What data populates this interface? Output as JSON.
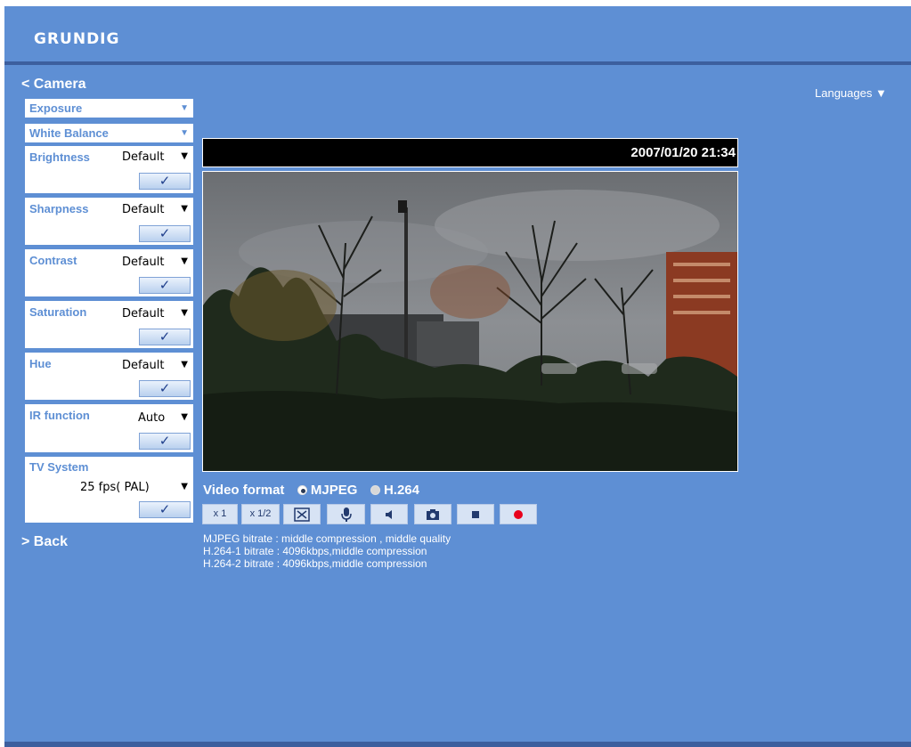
{
  "brand": {
    "logo": "GRUNDIG"
  },
  "nav": {
    "camera_link": "< Camera",
    "back_link": "> Back",
    "languages": "Languages ▼"
  },
  "sidebar": {
    "dropdowns": [
      {
        "label": "Exposure",
        "arrow": "▼"
      },
      {
        "label": "White Balance",
        "arrow": "▼"
      }
    ],
    "settings": [
      {
        "label": "Brightness",
        "value": "Default"
      },
      {
        "label": "Sharpness",
        "value": "Default"
      },
      {
        "label": "Contrast",
        "value": "Default"
      },
      {
        "label": "Saturation",
        "value": "Default"
      },
      {
        "label": "Hue",
        "value": "Default"
      },
      {
        "label": "IR function",
        "value": "Auto"
      },
      {
        "label": "TV System",
        "value": "25 fps( PAL)"
      }
    ],
    "select_caret": "▼",
    "apply_glyph": "✓"
  },
  "video": {
    "timestamp": "2007/01/20 21:34"
  },
  "format": {
    "label": "Video format",
    "options": [
      {
        "label": "MJPEG",
        "selected": true
      },
      {
        "label": "H.264",
        "selected": false
      }
    ]
  },
  "controls": {
    "zoom_x1": "x 1",
    "zoom_half": "x 1/2",
    "fullscreen_icon": "fullscreen-icon",
    "mic_icon": "microphone-icon",
    "speaker_icon": "speaker-icon",
    "snapshot_icon": "camera-icon",
    "stop_icon": "stop-icon",
    "record_icon": "record-icon"
  },
  "info_lines": [
    "MJPEG bitrate : middle compression , middle quality",
    "H.264-1 bitrate : 4096kbps,middle compression",
    "H.264-2 bitrate : 4096kbps,middle compression"
  ],
  "colors": {
    "frame": "#3C5F9E",
    "panel": "#5E8FD4",
    "label": "#5E8FD4",
    "record": "#E8001C"
  }
}
